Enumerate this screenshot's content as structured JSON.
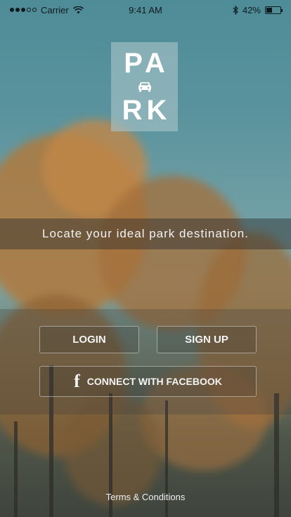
{
  "status_bar": {
    "carrier": "Carrier",
    "time": "9:41 AM",
    "battery_text": "42%",
    "battery_level": 0.42
  },
  "logo": {
    "line1": "PA",
    "line2": "RK"
  },
  "tagline": "Locate your ideal park destination.",
  "buttons": {
    "login": "LOGIN",
    "signup": "SIGN UP",
    "facebook": "CONNECT WITH FACEBOOK",
    "facebook_icon": "f"
  },
  "footer": {
    "terms": "Terms & Conditions"
  }
}
